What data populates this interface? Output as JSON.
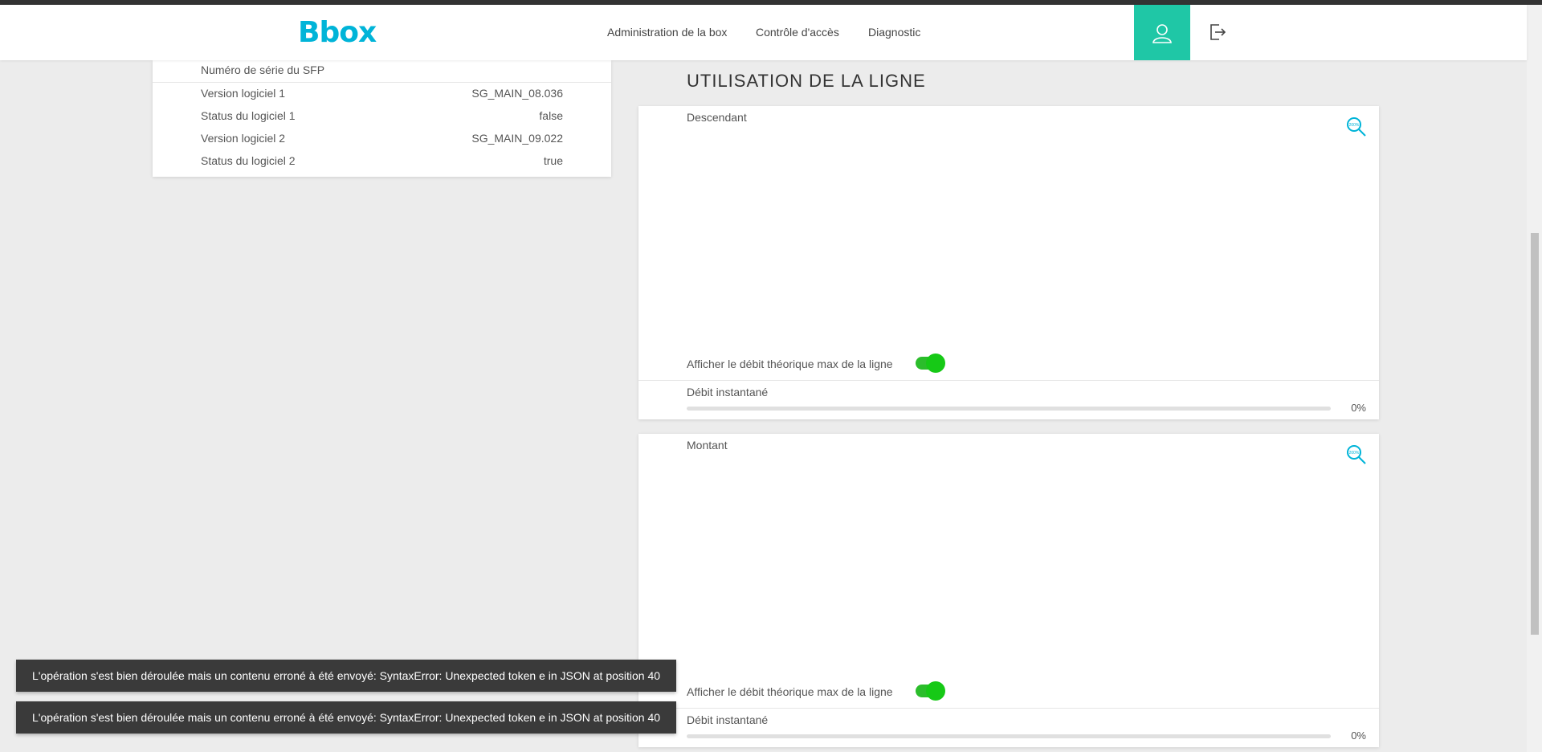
{
  "header": {
    "logo": "Bbox",
    "nav": [
      "Administration de la box",
      "Contrôle d'accès",
      "Diagnostic"
    ],
    "user_icon": "user-icon",
    "logout_icon": "logout-icon"
  },
  "info": {
    "rows": [
      {
        "label": "Numéro de série du SFP",
        "value": ""
      },
      {
        "label": "Version logiciel 1",
        "value": "SG_MAIN_08.036"
      },
      {
        "label": "Status du logiciel 1",
        "value": "false"
      },
      {
        "label": "Version logiciel 2",
        "value": "SG_MAIN_09.022"
      },
      {
        "label": "Status du logiciel 2",
        "value": "true"
      }
    ]
  },
  "section": {
    "title": "UTILISATION DE LA LIGNE"
  },
  "graphs": [
    {
      "label": "Descendant",
      "toggle_label": "Afficher le débit théorique max de la ligne",
      "toggle_on": true,
      "rate_label": "Débit instantané",
      "rate_pct_text": "0%",
      "rate_fraction": 0
    },
    {
      "label": "Montant",
      "toggle_label": "Afficher le débit théorique max de la ligne",
      "toggle_on": true,
      "rate_label": "Débit instantané",
      "rate_pct_text": "0%",
      "rate_fraction": 0
    }
  ],
  "toasts": [
    "L'opération s'est bien déroulée mais un contenu erroné à été envoyé: SyntaxError: Unexpected token e in JSON at position 40",
    "L'opération s'est bien déroulée mais un contenu erroné à été envoyé: SyntaxError: Unexpected token e in JSON at position 40"
  ],
  "colors": {
    "brand": "#00b4d8",
    "accent": "#1fc7a6",
    "toggle_on": "#16c916",
    "toast_bg": "#3a3a3a"
  }
}
